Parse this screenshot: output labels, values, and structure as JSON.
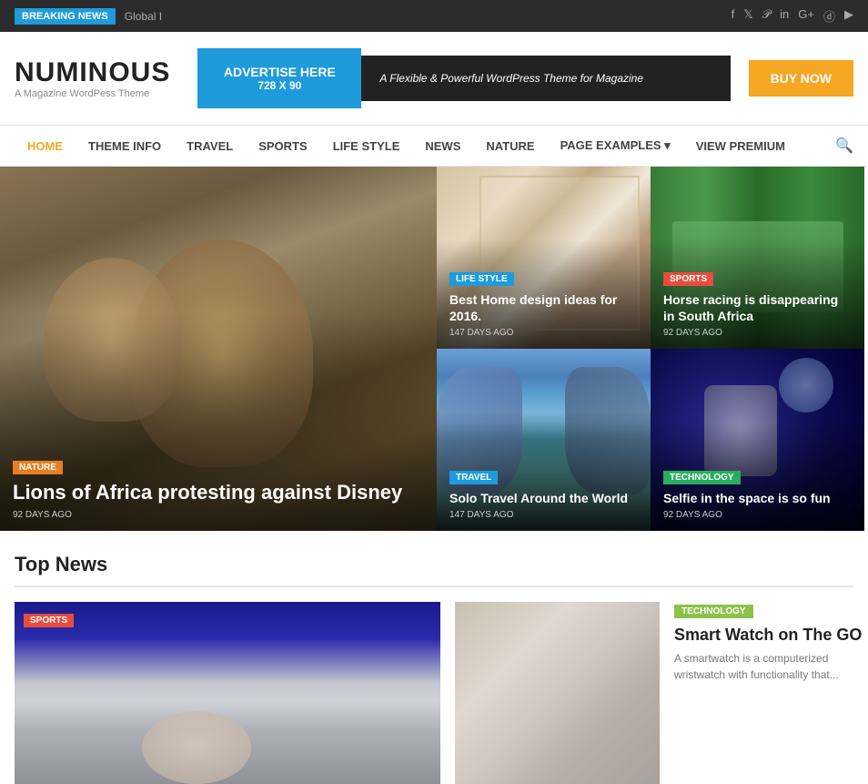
{
  "breaking": {
    "label": "BREAKING NEWS",
    "text": "Global I"
  },
  "social": {
    "icons": [
      "f",
      "t",
      "p",
      "in",
      "g+",
      "📷",
      "▶"
    ]
  },
  "header": {
    "logo": "NUMINOUS",
    "tagline": "A Magazine WordPess Theme",
    "ad": {
      "line1": "ADVERTISE HERE",
      "line2": "728 X 90",
      "description": "A Flexible & Powerful WordPress Theme for Magazine",
      "button": "BUY NOW"
    }
  },
  "nav": {
    "items": [
      {
        "label": "HOME",
        "active": true
      },
      {
        "label": "THEME INFO",
        "active": false
      },
      {
        "label": "TRAVEL",
        "active": false
      },
      {
        "label": "SPORTS",
        "active": false
      },
      {
        "label": "LIFE STYLE",
        "active": false
      },
      {
        "label": "NEWS",
        "active": false
      },
      {
        "label": "NATURE",
        "active": false
      },
      {
        "label": "PAGE EXAMPLES",
        "active": false,
        "dropdown": true
      },
      {
        "label": "VIEW PREMIUM",
        "active": false
      }
    ]
  },
  "featured": {
    "main": {
      "category": "NATURE",
      "title": "Lions of Africa protesting against Disney",
      "date": "92 DAYS AGO"
    },
    "top_right": {
      "category": "LIFE STYLE",
      "title": "Best Home design ideas for 2016.",
      "date": "147 DAYS AGO"
    },
    "top_far_right": {
      "category": "SPORTS",
      "title": "Horse racing is disappearing in South Africa",
      "date": "92 DAYS AGO"
    },
    "bottom_right": {
      "category": "TRAVEL",
      "title": "Solo Travel Around the World",
      "date": "147 DAYS AGO"
    },
    "bottom_far_right": {
      "category": "TECHNOLOGY",
      "title": "Selfie in the space is so fun",
      "date": "92 DAYS AGO"
    }
  },
  "top_news": {
    "section_title": "Top News",
    "cards": [
      {
        "category": "SPORTS",
        "badge_class": "badge-sports",
        "title": "",
        "desc": ""
      },
      {
        "category": "",
        "title": "",
        "desc": ""
      },
      {
        "category": "TECHNOLOGY",
        "badge_class": "badge-technology-plain",
        "title": "Smart Watch on The GO",
        "desc": "A smartwatch is a computerized wristwatch with functionality that..."
      }
    ]
  }
}
